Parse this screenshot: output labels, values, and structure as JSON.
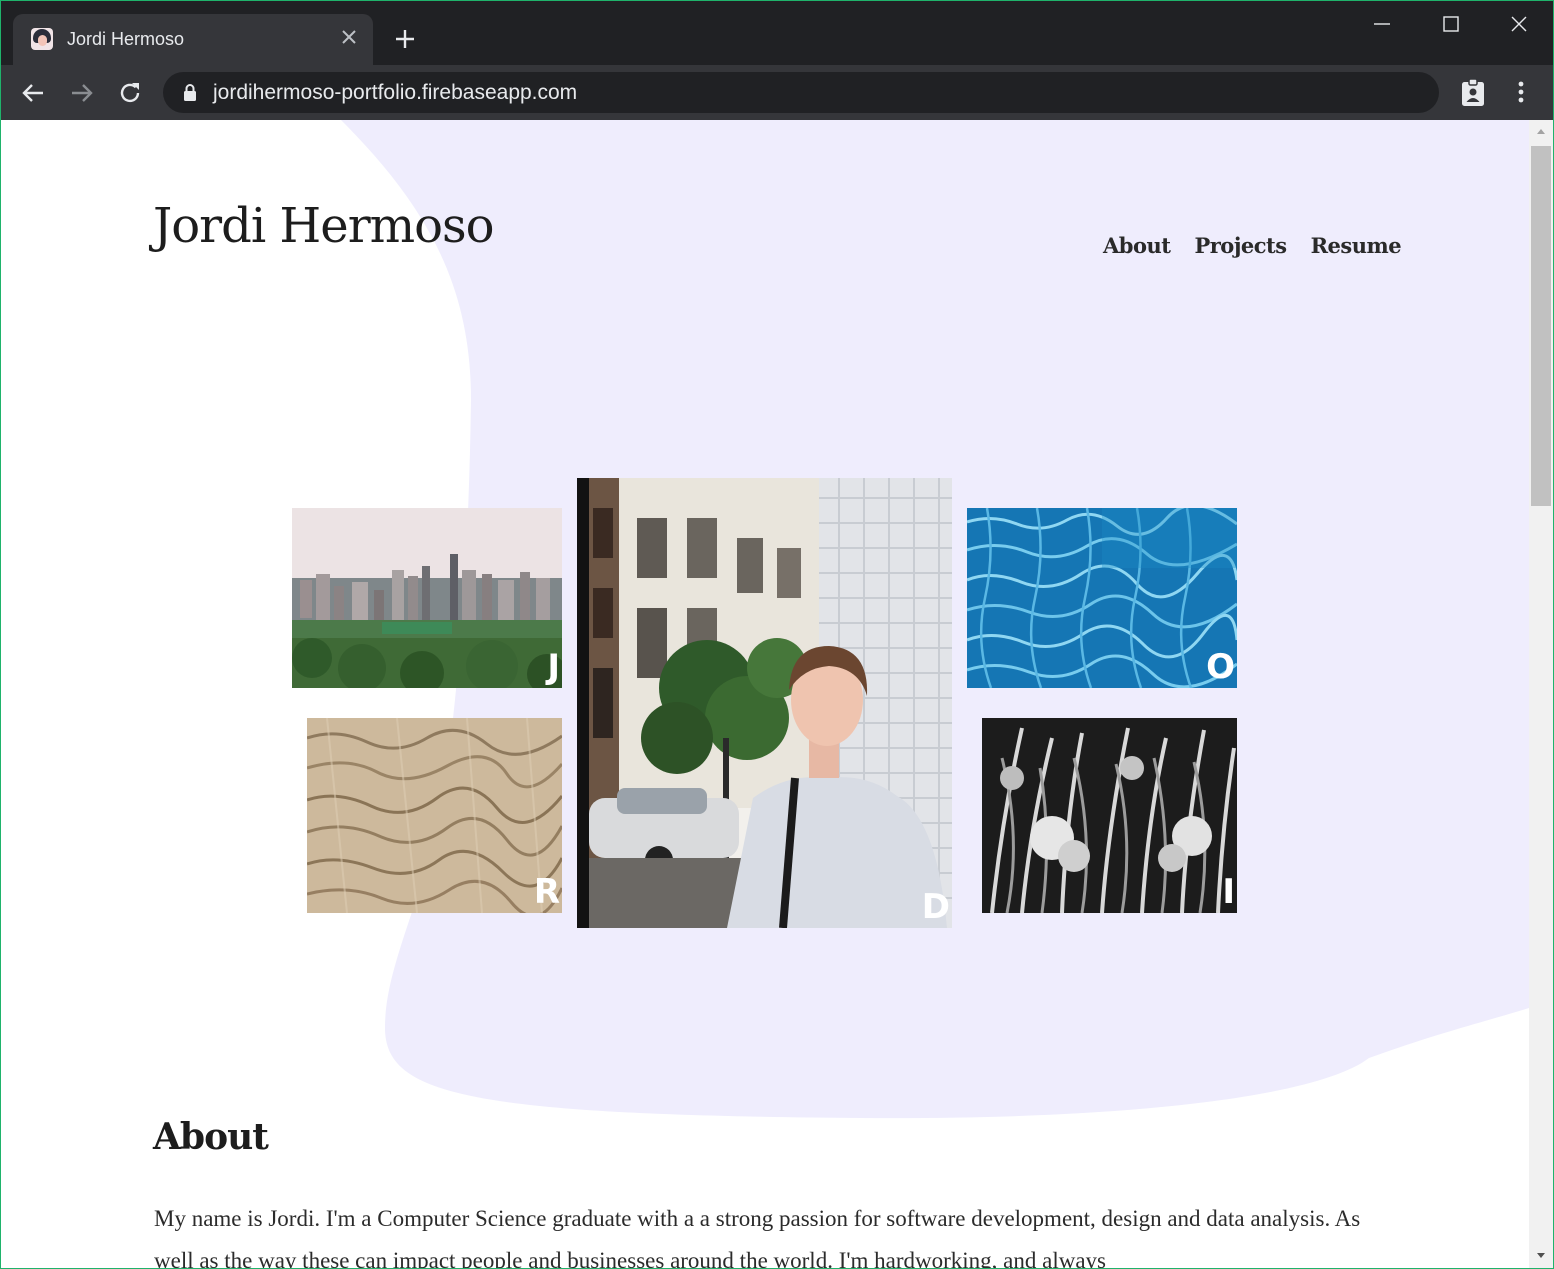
{
  "browser": {
    "tab_title": "Jordi Hermoso",
    "url": "jordihermoso-portfolio.firebaseapp.com"
  },
  "site": {
    "title": "Jordi Hermoso",
    "nav": [
      "About",
      "Projects",
      "Resume"
    ],
    "accent_bg": "#efedfd"
  },
  "gallery": {
    "letters": [
      "J",
      "R",
      "D",
      "O",
      "I"
    ]
  },
  "about": {
    "heading": "About",
    "paragraph": "My name is Jordi. I'm a Computer Science graduate with a a strong passion for software development, design and data analysis. As well as the way these can impact people and businesses around the world. I'm hardworking, and always"
  }
}
